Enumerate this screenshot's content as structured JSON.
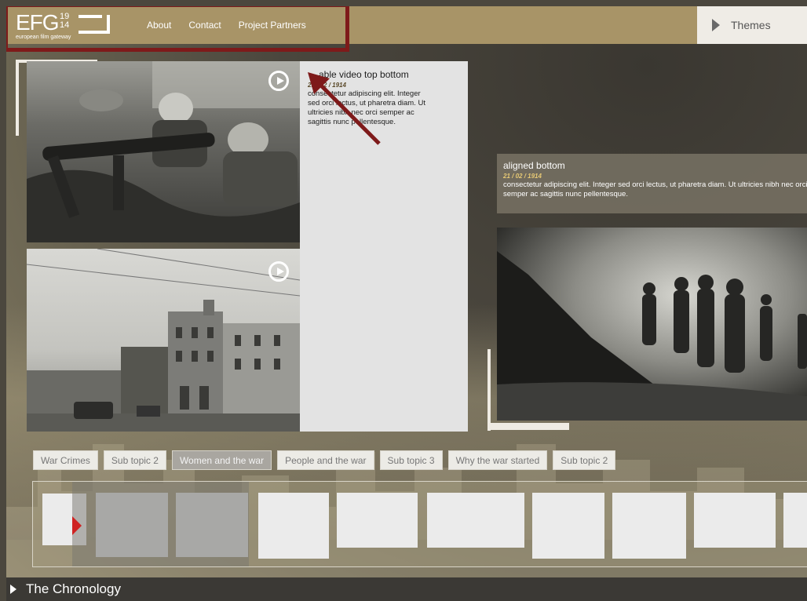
{
  "header": {
    "logo_text": "EFG",
    "logo_num_top": "19",
    "logo_num_bottom": "14",
    "logo_sub": "european film gateway",
    "nav": [
      "About",
      "Contact",
      "Project Partners"
    ],
    "themes_label": "Themes"
  },
  "card_left": {
    "title": "able video top bottom",
    "date": "21 / 02 / 1914",
    "lines": [
      "consectetur adipiscing elit. Integer",
      "sed orci lectus, ut pharetra diam. Ut",
      "ultricies nibh nec orci semper ac",
      "sagittis nunc pellentesque."
    ]
  },
  "card_right": {
    "title": "aligned bottom",
    "date": "21 / 02 / 1914",
    "lines": [
      "consectetur adipiscing elit. Integer sed orci lectus, ut pharetra diam. Ut ultricies nibh nec orci",
      "semper ac sagittis nunc pellentesque."
    ]
  },
  "topics": [
    "War Crimes",
    "Sub topic 2",
    "Women and the war",
    "People and the war",
    "Sub topic 3",
    "Why the war started",
    "Sub topic 2"
  ],
  "active_topic": "Women and the war",
  "chronology_label": "The Chronology",
  "colors": {
    "header": "#a89467",
    "highlight": "#7e1a1a",
    "marker": "#cf2222"
  }
}
